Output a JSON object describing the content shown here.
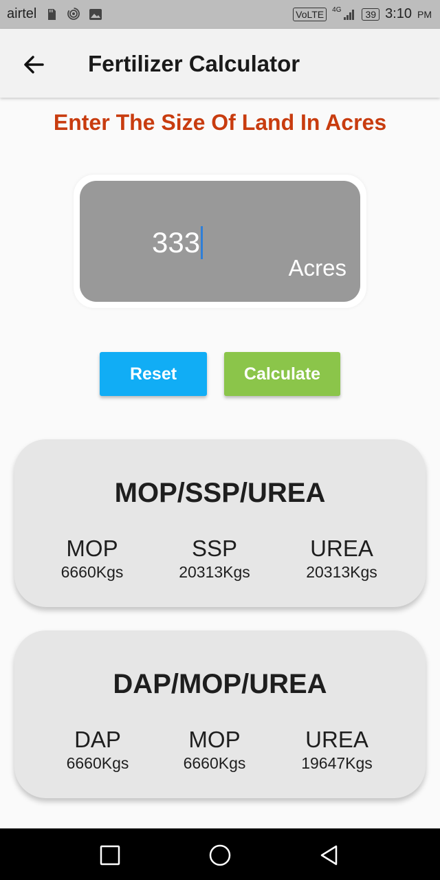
{
  "status_bar": {
    "carrier": "airtel",
    "network_badge": "VoLTE",
    "network_type": "4G",
    "battery": "39",
    "time": "3:10",
    "ampm": "PM",
    "icons": [
      "sd-card-icon",
      "hotspot-icon",
      "image-icon",
      "signal-icon",
      "battery-icon"
    ]
  },
  "app_bar": {
    "title": "Fertilizer Calculator",
    "back_icon": "arrow-left-icon"
  },
  "prompt": "Enter The Size Of Land In Acres",
  "land_input": {
    "value": "333",
    "suffix": "Acres"
  },
  "buttons": {
    "reset": "Reset",
    "calculate": "Calculate"
  },
  "results": [
    {
      "title": "MOP/SSP/UREA",
      "items": [
        {
          "name": "MOP",
          "value": "6660Kgs"
        },
        {
          "name": "SSP",
          "value": "20313Kgs"
        },
        {
          "name": "UREA",
          "value": "20313Kgs"
        }
      ]
    },
    {
      "title": "DAP/MOP/UREA",
      "items": [
        {
          "name": "DAP",
          "value": "6660Kgs"
        },
        {
          "name": "MOP",
          "value": "6660Kgs"
        },
        {
          "name": "UREA",
          "value": "19647Kgs"
        }
      ]
    }
  ],
  "nav_bar": {
    "icons": [
      "recents-square-icon",
      "home-circle-icon",
      "back-triangle-icon"
    ]
  },
  "colors": {
    "prompt": "#c83c0f",
    "reset_button": "#11adf5",
    "calculate_button": "#8bc54a",
    "input_fill": "#999999",
    "card_fill": "#e6e6e6"
  }
}
